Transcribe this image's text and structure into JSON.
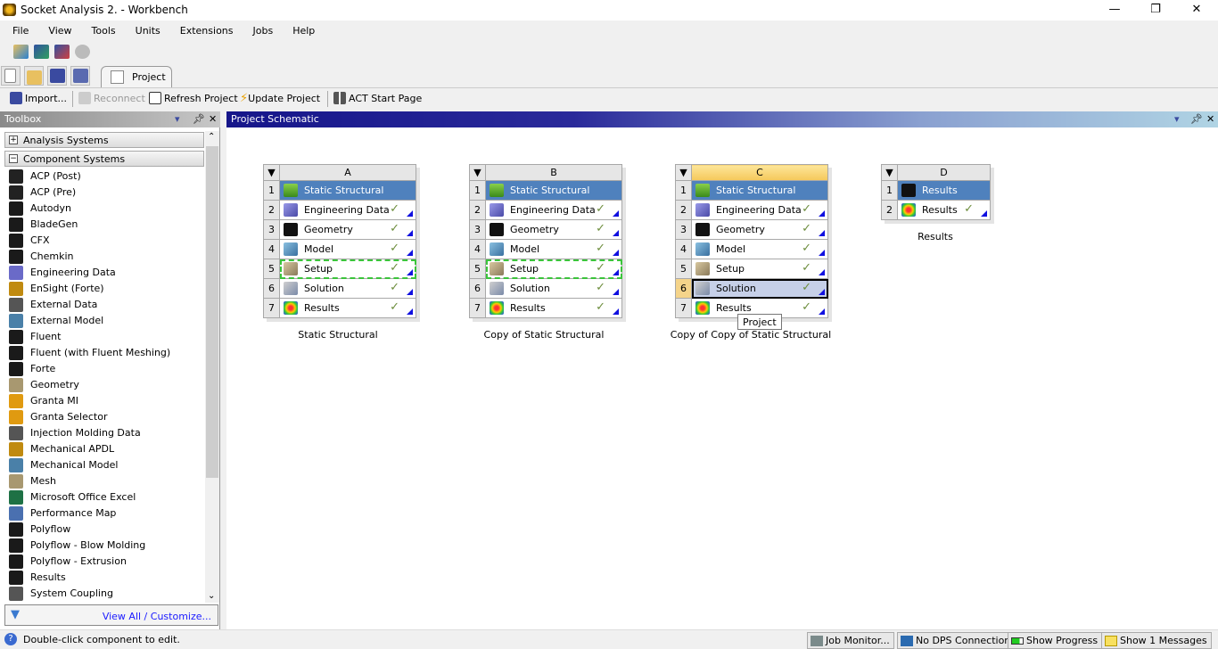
{
  "window": {
    "title": "Socket Analysis 2. - Workbench",
    "minimize": "—",
    "maximize": "❐",
    "close": "✕"
  },
  "menu": [
    "File",
    "View",
    "Tools",
    "Units",
    "Extensions",
    "Jobs",
    "Help"
  ],
  "tab": {
    "label": "Project"
  },
  "toolbar": {
    "import": "Import...",
    "reconnect": "Reconnect",
    "refresh": "Refresh Project",
    "update": "Update Project",
    "act": "ACT Start Page"
  },
  "toolbox": {
    "title": "Toolbox",
    "groups": [
      {
        "label": "Analysis Systems",
        "state": "+"
      },
      {
        "label": "Component Systems",
        "state": "−"
      }
    ],
    "items": [
      {
        "label": "ACP (Post)",
        "icon": "acp-post-icon",
        "color": "#222"
      },
      {
        "label": "ACP (Pre)",
        "icon": "acp-pre-icon",
        "color": "#222"
      },
      {
        "label": "Autodyn",
        "icon": "autodyn-icon",
        "color": "#1a1a1a"
      },
      {
        "label": "BladeGen",
        "icon": "bladegen-icon",
        "color": "#1a1a1a"
      },
      {
        "label": "CFX",
        "icon": "cfx-icon",
        "color": "#1a1a1a"
      },
      {
        "label": "Chemkin",
        "icon": "chemkin-icon",
        "color": "#1a1a1a"
      },
      {
        "label": "Engineering Data",
        "icon": "engineering-data-icon",
        "color": "#6a6ac8"
      },
      {
        "label": "EnSight (Forte)",
        "icon": "ensight-icon",
        "color": "#c08a10"
      },
      {
        "label": "External Data",
        "icon": "external-data-icon",
        "color": "#555"
      },
      {
        "label": "External Model",
        "icon": "external-model-icon",
        "color": "#4a80a8"
      },
      {
        "label": "Fluent",
        "icon": "fluent-icon",
        "color": "#1a1a1a"
      },
      {
        "label": "Fluent (with Fluent Meshing)",
        "icon": "fluent-meshing-icon",
        "color": "#1a1a1a"
      },
      {
        "label": "Forte",
        "icon": "forte-icon",
        "color": "#1a1a1a"
      },
      {
        "label": "Geometry",
        "icon": "geometry-icon",
        "color": "#a89870"
      },
      {
        "label": "Granta MI",
        "icon": "granta-mi-icon",
        "color": "#e09a10"
      },
      {
        "label": "Granta Selector",
        "icon": "granta-selector-icon",
        "color": "#e09a10"
      },
      {
        "label": "Injection Molding Data",
        "icon": "injection-molding-icon",
        "color": "#555"
      },
      {
        "label": "Mechanical APDL",
        "icon": "mechanical-apdl-icon",
        "color": "#c08a10"
      },
      {
        "label": "Mechanical Model",
        "icon": "mechanical-model-icon",
        "color": "#4a80a8"
      },
      {
        "label": "Mesh",
        "icon": "mesh-icon",
        "color": "#a89870"
      },
      {
        "label": "Microsoft Office Excel",
        "icon": "excel-icon",
        "color": "#1e7145"
      },
      {
        "label": "Performance Map",
        "icon": "performance-map-icon",
        "color": "#4a70b0"
      },
      {
        "label": "Polyflow",
        "icon": "polyflow-icon",
        "color": "#1a1a1a"
      },
      {
        "label": "Polyflow - Blow Molding",
        "icon": "polyflow-blow-icon",
        "color": "#1a1a1a"
      },
      {
        "label": "Polyflow - Extrusion",
        "icon": "polyflow-extrusion-icon",
        "color": "#1a1a1a"
      },
      {
        "label": "Results",
        "icon": "results-icon",
        "color": "#1a1a1a"
      },
      {
        "label": "System Coupling",
        "icon": "system-coupling-icon",
        "color": "#555"
      }
    ],
    "view_all": "View All / Customize..."
  },
  "schematic": {
    "title": "Project Schematic",
    "tooltip": "Project",
    "systems": [
      {
        "letter": "A",
        "name": "Static Structural",
        "rows": [
          {
            "n": "1",
            "label": "Static Structural",
            "icon": "static-structural-icon",
            "check": ""
          },
          {
            "n": "2",
            "label": "Engineering Data",
            "icon": "engineering-data-icon",
            "check": "✓"
          },
          {
            "n": "3",
            "label": "Geometry",
            "icon": "geometry-icon",
            "check": "✓"
          },
          {
            "n": "4",
            "label": "Model",
            "icon": "model-icon",
            "check": "✓"
          },
          {
            "n": "5",
            "label": "Setup",
            "icon": "setup-icon",
            "check": "✓"
          },
          {
            "n": "6",
            "label": "Solution",
            "icon": "solution-icon",
            "check": "✓"
          },
          {
            "n": "7",
            "label": "Results",
            "icon": "results-icon",
            "check": "✓"
          }
        ]
      },
      {
        "letter": "B",
        "name": "Copy of Static Structural",
        "rows": [
          {
            "n": "1",
            "label": "Static Structural",
            "icon": "static-structural-icon",
            "check": ""
          },
          {
            "n": "2",
            "label": "Engineering Data",
            "icon": "engineering-data-icon",
            "check": "✓"
          },
          {
            "n": "3",
            "label": "Geometry",
            "icon": "geometry-icon",
            "check": "✓"
          },
          {
            "n": "4",
            "label": "Model",
            "icon": "model-icon",
            "check": "✓"
          },
          {
            "n": "5",
            "label": "Setup",
            "icon": "setup-icon",
            "check": "✓"
          },
          {
            "n": "6",
            "label": "Solution",
            "icon": "solution-icon",
            "check": "✓"
          },
          {
            "n": "7",
            "label": "Results",
            "icon": "results-icon",
            "check": "✓"
          }
        ]
      },
      {
        "letter": "C",
        "name": "Copy of Copy of Static Structural",
        "rows": [
          {
            "n": "1",
            "label": "Static Structural",
            "icon": "static-structural-icon",
            "check": ""
          },
          {
            "n": "2",
            "label": "Engineering Data",
            "icon": "engineering-data-icon",
            "check": "✓"
          },
          {
            "n": "3",
            "label": "Geometry",
            "icon": "geometry-icon",
            "check": "✓"
          },
          {
            "n": "4",
            "label": "Model",
            "icon": "model-icon",
            "check": "✓"
          },
          {
            "n": "5",
            "label": "Setup",
            "icon": "setup-icon",
            "check": "✓"
          },
          {
            "n": "6",
            "label": "Solution",
            "icon": "solution-icon",
            "check": "✓"
          },
          {
            "n": "7",
            "label": "Results",
            "icon": "results-icon",
            "check": "✓"
          }
        ]
      },
      {
        "letter": "D",
        "name": "Results",
        "rows": [
          {
            "n": "1",
            "label": "Results",
            "icon": "results-system-icon",
            "check": ""
          },
          {
            "n": "2",
            "label": "Results",
            "icon": "results-icon",
            "check": "✓"
          }
        ]
      }
    ]
  },
  "status": {
    "message": "Double-click component to edit.",
    "job_monitor": "Job Monitor...",
    "dps": "No DPS Connection",
    "progress": "Show Progress",
    "messages": "Show 1 Messages"
  }
}
